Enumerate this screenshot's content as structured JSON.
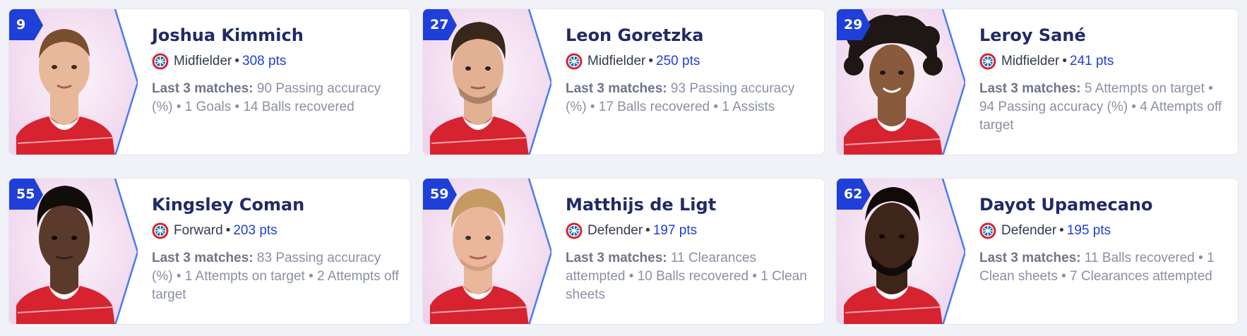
{
  "players": [
    {
      "number": "9",
      "name": "Joshua Kimmich",
      "position": "Midfielder",
      "separator": "•",
      "points": "308 pts",
      "stats_label": "Last 3 matches:",
      "stats_text": " 90 Passing accuracy (%) • 1 Goals • 14 Balls recovered"
    },
    {
      "number": "27",
      "name": "Leon Goretzka",
      "position": "Midfielder",
      "separator": "•",
      "points": "250 pts",
      "stats_label": "Last 3 matches:",
      "stats_text": " 93 Passing accuracy (%) • 17 Balls recovered • 1 Assists"
    },
    {
      "number": "29",
      "name": "Leroy Sané",
      "position": "Midfielder",
      "separator": "•",
      "points": "241 pts",
      "stats_label": "Last 3 matches:",
      "stats_text": " 5 Attempts on target • 94 Passing accuracy (%) • 4 Attempts off target"
    },
    {
      "number": "55",
      "name": "Kingsley Coman",
      "position": "Forward",
      "separator": "•",
      "points": "203 pts",
      "stats_label": "Last 3 matches:",
      "stats_text": " 83 Passing accuracy (%) • 1 Attempts on target • 2 Attempts off target"
    },
    {
      "number": "59",
      "name": "Matthijs de Ligt",
      "position": "Defender",
      "separator": "•",
      "points": "197 pts",
      "stats_label": "Last 3 matches:",
      "stats_text": " 11 Clearances attempted • 10 Balls recovered • 1 Clean sheets"
    },
    {
      "number": "62",
      "name": "Dayot Upamecano",
      "position": "Defender",
      "separator": "•",
      "points": "195 pts",
      "stats_label": "Last 3 matches:",
      "stats_text": " 11 Balls recovered • 1 Clean sheets • 7 Clearances attempted"
    }
  ],
  "icons": {
    "club_logo": "fc-bayern-logo-icon",
    "player_photo": "player-photo"
  },
  "colors": {
    "accent": "#1f3fd9",
    "name": "#202a66",
    "kit": "#d6232f",
    "photo_bg": "#f2dff0"
  }
}
